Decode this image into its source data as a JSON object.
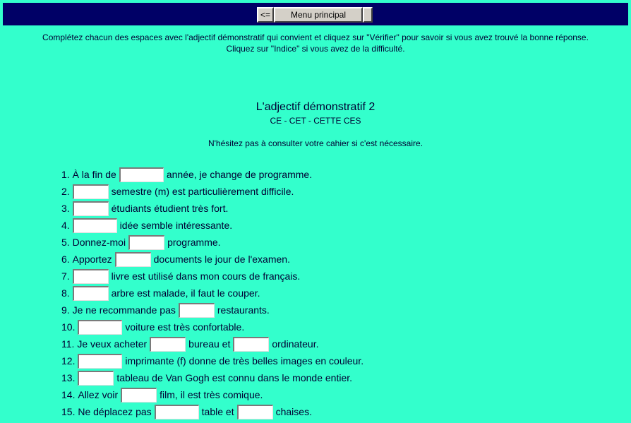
{
  "nav": {
    "back_label": "<=",
    "main_label": "Menu principal",
    "blank_label": ""
  },
  "instructions": {
    "line1": "Complétez chacun des espaces avec l'adjectif démonstratif qui convient et cliquez sur \"Vérifier\" pour savoir si vous avez trouvé la bonne réponse.",
    "line2": "Cliquez sur \"Indice\" si vous avez de la difficulté."
  },
  "title": "L'adjectif démonstratif 2",
  "subtitle": "CE - CET - CETTE CES",
  "note": "N'hésitez pas à consulter votre cahier si c'est nécessaire.",
  "questions": [
    {
      "n": "1.",
      "parts": [
        "À la fin de",
        "année, je change de programme."
      ]
    },
    {
      "n": "2.",
      "parts": [
        "",
        "semestre (m) est particulièrement difficile."
      ]
    },
    {
      "n": "3.",
      "parts": [
        "",
        "étudiants étudient très fort."
      ]
    },
    {
      "n": "4.",
      "parts": [
        "",
        "idée semble intéressante."
      ]
    },
    {
      "n": "5.",
      "parts": [
        "Donnez-moi",
        "programme."
      ]
    },
    {
      "n": "6.",
      "parts": [
        "Apportez",
        "documents le jour de l'examen."
      ]
    },
    {
      "n": "7.",
      "parts": [
        "",
        "livre est utilisé dans mon cours de français."
      ]
    },
    {
      "n": "8.",
      "parts": [
        "",
        "arbre est malade, il faut le couper."
      ]
    },
    {
      "n": "9.",
      "parts": [
        "Je ne recommande pas",
        "restaurants."
      ]
    },
    {
      "n": "10.",
      "parts": [
        "",
        "voiture est très confortable."
      ]
    },
    {
      "n": "11.",
      "parts": [
        "Je veux acheter",
        "bureau et",
        "ordinateur."
      ]
    },
    {
      "n": "12.",
      "parts": [
        "",
        "imprimante (f) donne de très belles images en couleur."
      ]
    },
    {
      "n": "13.",
      "parts": [
        "",
        "tableau de Van Gogh est connu dans le monde entier."
      ]
    },
    {
      "n": "14.",
      "parts": [
        "Allez voir",
        "film, il est très comique."
      ]
    },
    {
      "n": "15.",
      "parts": [
        "Ne déplacez pas",
        "table et",
        "chaises."
      ]
    }
  ]
}
